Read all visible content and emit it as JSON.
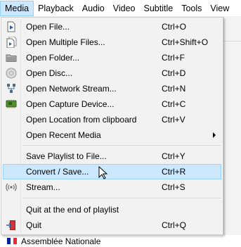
{
  "menubar": {
    "items": [
      {
        "label": "Media"
      },
      {
        "label": "Playback"
      },
      {
        "label": "Audio"
      },
      {
        "label": "Video"
      },
      {
        "label": "Subtitle"
      },
      {
        "label": "Tools"
      },
      {
        "label": "View"
      }
    ]
  },
  "media_menu": {
    "items": [
      {
        "label": "Open File...",
        "shortcut": "Ctrl+O",
        "icon": "file-play-icon"
      },
      {
        "label": "Open Multiple Files...",
        "shortcut": "Ctrl+Shift+O",
        "icon": "files-play-icon"
      },
      {
        "label": "Open Folder...",
        "shortcut": "Ctrl+F",
        "icon": "folder-icon"
      },
      {
        "label": "Open Disc...",
        "shortcut": "Ctrl+D",
        "icon": "disc-icon"
      },
      {
        "label": "Open Network Stream...",
        "shortcut": "Ctrl+N",
        "icon": "network-icon"
      },
      {
        "label": "Open Capture Device...",
        "shortcut": "Ctrl+C",
        "icon": "capture-card-icon"
      },
      {
        "label": "Open Location from clipboard",
        "shortcut": "Ctrl+V",
        "icon": ""
      },
      {
        "label": "Open Recent Media",
        "shortcut": "",
        "icon": "",
        "submenu": true
      },
      {
        "label": "Save Playlist to File...",
        "shortcut": "Ctrl+Y",
        "icon": ""
      },
      {
        "label": "Convert / Save...",
        "shortcut": "Ctrl+R",
        "icon": "",
        "highlighted": true
      },
      {
        "label": "Stream...",
        "shortcut": "Ctrl+S",
        "icon": "stream-icon"
      },
      {
        "label": "Quit at the end of playlist",
        "shortcut": "",
        "icon": ""
      },
      {
        "label": "Quit",
        "shortcut": "Ctrl+Q",
        "icon": "quit-icon"
      }
    ]
  },
  "background": {
    "bottom_item_label": "Assemblée Nationale"
  },
  "colors": {
    "highlight_bg": "#cce8ff",
    "highlight_border": "#99d1ff",
    "menu_bg": "#f2f2f2",
    "flag_blue": "#002395",
    "flag_white": "#ffffff",
    "flag_red": "#ed2939"
  }
}
